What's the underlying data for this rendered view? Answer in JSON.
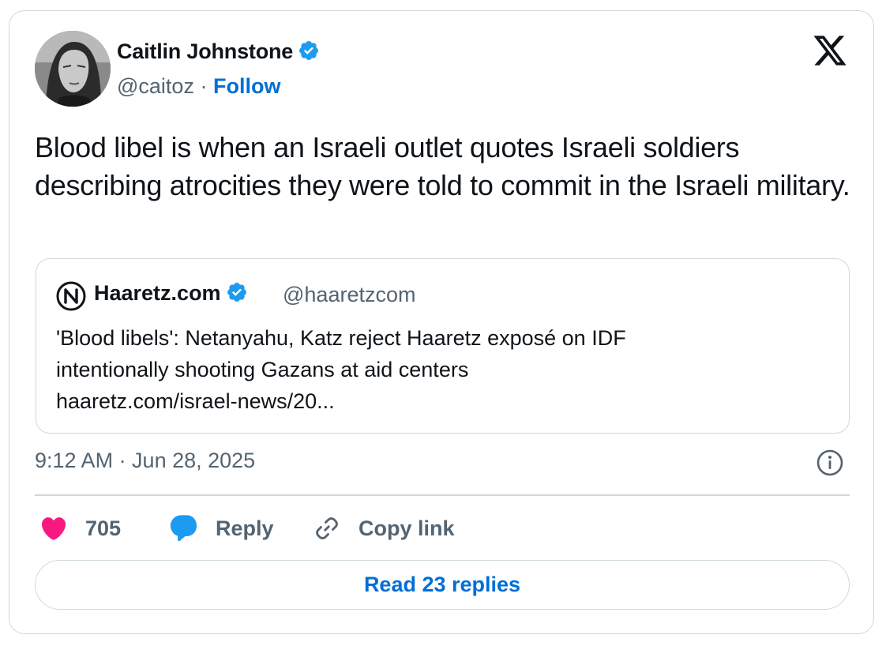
{
  "tweet": {
    "author": {
      "name": "Caitlin Johnstone",
      "handle": "@caitoz",
      "separator": "·",
      "follow_label": "Follow",
      "avatar_icon": "avatar-portrait",
      "verified_icon": "verified-badge-icon"
    },
    "text": "Blood libel is when an Israeli outlet quotes Israeli soldiers describing atrocities they were told to commit in the Israeli military.",
    "quoted": {
      "name": "Haaretz.com",
      "handle": "@haaretzcom",
      "logo_icon": "haaretz-logo-icon",
      "text_line1": "'Blood libels': Netanyahu, Katz reject Haaretz exposé on IDF",
      "text_line2": "intentionally shooting Gazans at aid centers",
      "link": "haaretz.com/israel-news/20..."
    },
    "timestamp": "9:12 AM · Jun 28, 2025",
    "actions": {
      "like_count": "705",
      "reply_label": "Reply",
      "copy_label": "Copy link"
    },
    "read_replies_label": "Read 23 replies"
  },
  "colors": {
    "brand_blue": "#006fd6",
    "verified_blue": "#1d9bf0",
    "like_pink": "#f91880",
    "text_primary": "#0f1419",
    "text_secondary": "#536471",
    "border": "#cfd9de"
  }
}
